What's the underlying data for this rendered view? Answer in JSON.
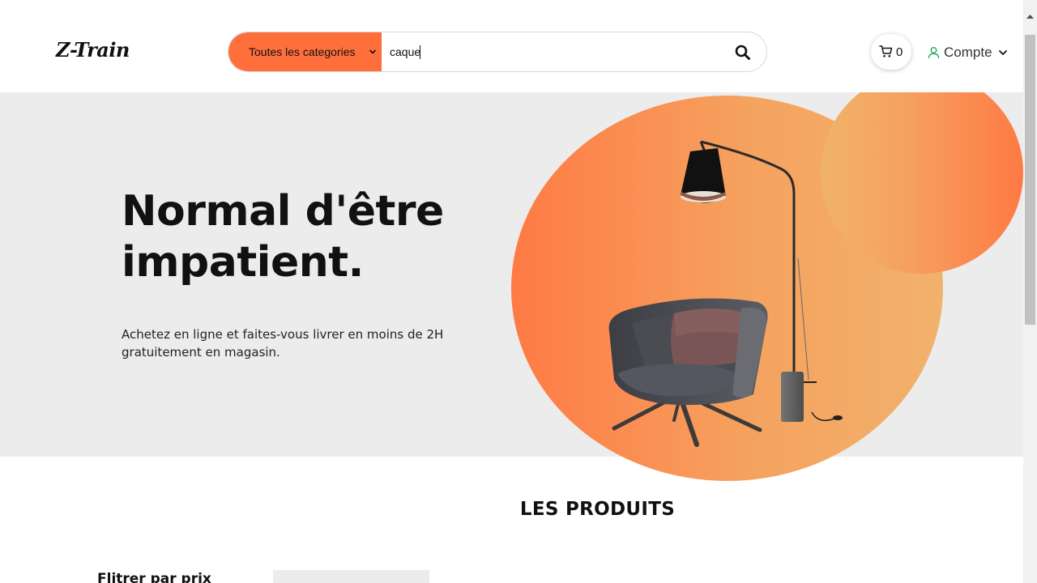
{
  "header": {
    "logo": "Z-Train",
    "search": {
      "category_selected": "Toutes les categories",
      "query": "caque"
    },
    "cart": {
      "count": "0"
    },
    "account": {
      "label": "Compte"
    }
  },
  "hero": {
    "title_line1": "Normal d'être",
    "title_line2": "impatient.",
    "text_line1": "Achetez en ligne et faites-vous livrer en moins de 2H",
    "text_line2": "gratuitement en magasin."
  },
  "products": {
    "title": "LES PRODUITS",
    "filter_title": "Flitrer par prix"
  },
  "colors": {
    "accent": "#ff6f3c",
    "hero_bg": "#ececec",
    "account_icon": "#27ae60"
  },
  "icons": {
    "search": "search-icon",
    "cart": "cart-icon",
    "user": "user-icon",
    "chevron": "chevron-down-icon"
  }
}
